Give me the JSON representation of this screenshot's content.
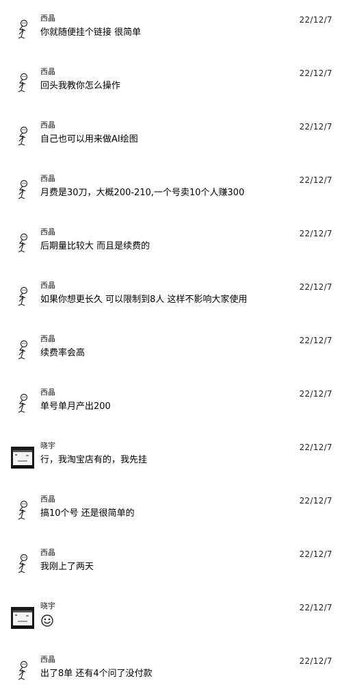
{
  "messages": [
    {
      "sender": "西晶",
      "time": "22/12/7",
      "text": "你就随便挂个链接 很简单"
    },
    {
      "sender": "西晶",
      "time": "22/12/7",
      "text": "回头我教你怎么操作"
    },
    {
      "sender": "西晶",
      "time": "22/12/7",
      "text": "自己也可以用来做AI绘图"
    },
    {
      "sender": "西晶",
      "time": "22/12/7",
      "text": "月费是30刀，大概200-210,一个号卖10个人赚300"
    },
    {
      "sender": "西晶",
      "time": "22/12/7",
      "text": "后期量比较大 而且是续费的"
    },
    {
      "sender": "西晶",
      "time": "22/12/7",
      "text": "如果你想更长久 可以限制到8人 这样不影响大家使用"
    },
    {
      "sender": "西晶",
      "time": "22/12/7",
      "text": "续费率会高"
    },
    {
      "sender": "西晶",
      "time": "22/12/7",
      "text": "单号单月产出200"
    },
    {
      "sender": "晓宇",
      "time": "22/12/7",
      "text": "行，我淘宝店有的，我先挂"
    },
    {
      "sender": "西晶",
      "time": "22/12/7",
      "text": "搞10个号 还是很简单的"
    },
    {
      "sender": "西晶",
      "time": "22/12/7",
      "text": "我刚上了两天"
    },
    {
      "sender": "晓宇",
      "time": "22/12/7",
      "text": "",
      "emoji": "smile-emoji-icon"
    },
    {
      "sender": "西晶",
      "time": "22/12/7",
      "text": "出了8单 还有4个问了没付款"
    }
  ],
  "avatars": {
    "西晶": "stick-figure-avatar-icon",
    "晓宇": "dark-pixel-avatar-icon"
  }
}
